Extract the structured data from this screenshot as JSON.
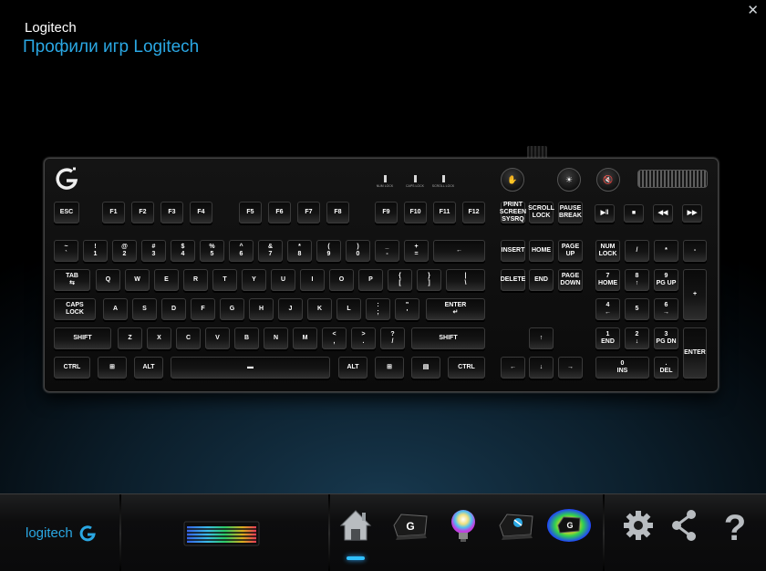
{
  "window": {
    "brand": "Logitech",
    "app_title": "Профили игр Logitech",
    "close_icon": "close-icon"
  },
  "keyboard": {
    "indicators": [
      "NUM LOCK",
      "CAPS LOCK",
      "SCROLL LOCK"
    ],
    "media_top": [
      "backlight-icon",
      "brightness-icon",
      "mute-icon"
    ],
    "keys": [
      {
        "name": "esc",
        "label": "ESC"
      },
      {
        "name": "f1",
        "label": "F1"
      },
      {
        "name": "f2",
        "label": "F2"
      },
      {
        "name": "f3",
        "label": "F3"
      },
      {
        "name": "f4",
        "label": "F4"
      },
      {
        "name": "f5",
        "label": "F5"
      },
      {
        "name": "f6",
        "label": "F6"
      },
      {
        "name": "f7",
        "label": "F7"
      },
      {
        "name": "f8",
        "label": "F8"
      },
      {
        "name": "f9",
        "label": "F9"
      },
      {
        "name": "f10",
        "label": "F10"
      },
      {
        "name": "f11",
        "label": "F11"
      },
      {
        "name": "f12",
        "label": "F12"
      },
      {
        "name": "print-screen",
        "label": "PRINT\nSCREEN\nSYSRQ"
      },
      {
        "name": "scroll-lock",
        "label": "SCROLL\nLOCK"
      },
      {
        "name": "pause-break",
        "label": "PAUSE\nBREAK"
      },
      {
        "name": "media-play-pause",
        "label": "▶ǁ"
      },
      {
        "name": "media-stop",
        "label": "■"
      },
      {
        "name": "media-prev",
        "label": "◀◀"
      },
      {
        "name": "media-next",
        "label": "▶▶"
      },
      {
        "name": "backtick",
        "label": "~\n`"
      },
      {
        "name": "digit-1",
        "label": "!\n1"
      },
      {
        "name": "digit-2",
        "label": "@\n2"
      },
      {
        "name": "digit-3",
        "label": "#\n3"
      },
      {
        "name": "digit-4",
        "label": "$\n4"
      },
      {
        "name": "digit-5",
        "label": "%\n5"
      },
      {
        "name": "digit-6",
        "label": "^\n6"
      },
      {
        "name": "digit-7",
        "label": "&\n7"
      },
      {
        "name": "digit-8",
        "label": "*\n8"
      },
      {
        "name": "digit-9",
        "label": "(\n9"
      },
      {
        "name": "digit-0",
        "label": ")\n0"
      },
      {
        "name": "minus",
        "label": "_\n-"
      },
      {
        "name": "equals",
        "label": "+\n="
      },
      {
        "name": "backspace",
        "label": "←"
      },
      {
        "name": "insert",
        "label": "INSERT"
      },
      {
        "name": "home",
        "label": "HOME"
      },
      {
        "name": "page-up",
        "label": "PAGE\nUP"
      },
      {
        "name": "num-lock",
        "label": "NUM\nLOCK"
      },
      {
        "name": "num-divide",
        "label": "/"
      },
      {
        "name": "num-multiply",
        "label": "*"
      },
      {
        "name": "num-minus",
        "label": "-"
      },
      {
        "name": "tab",
        "label": "TAB\n⇆"
      },
      {
        "name": "q",
        "label": "Q"
      },
      {
        "name": "w",
        "label": "W"
      },
      {
        "name": "e",
        "label": "E"
      },
      {
        "name": "r",
        "label": "R"
      },
      {
        "name": "t",
        "label": "T"
      },
      {
        "name": "y",
        "label": "Y"
      },
      {
        "name": "u",
        "label": "U"
      },
      {
        "name": "i",
        "label": "I"
      },
      {
        "name": "o",
        "label": "O"
      },
      {
        "name": "p",
        "label": "P"
      },
      {
        "name": "bracket-left",
        "label": "{\n["
      },
      {
        "name": "bracket-right",
        "label": "}\n]"
      },
      {
        "name": "backslash",
        "label": "|\n\\"
      },
      {
        "name": "delete",
        "label": "DELETE"
      },
      {
        "name": "end",
        "label": "END"
      },
      {
        "name": "page-down",
        "label": "PAGE\nDOWN"
      },
      {
        "name": "num-7",
        "label": "7\nHOME"
      },
      {
        "name": "num-8",
        "label": "8\n↑"
      },
      {
        "name": "num-9",
        "label": "9\nPG UP"
      },
      {
        "name": "num-plus",
        "label": "+"
      },
      {
        "name": "caps-lock",
        "label": "CAPS\nLOCK"
      },
      {
        "name": "a",
        "label": "A"
      },
      {
        "name": "s",
        "label": "S"
      },
      {
        "name": "d",
        "label": "D"
      },
      {
        "name": "f",
        "label": "F"
      },
      {
        "name": "g",
        "label": "G"
      },
      {
        "name": "h",
        "label": "H"
      },
      {
        "name": "j",
        "label": "J"
      },
      {
        "name": "k",
        "label": "K"
      },
      {
        "name": "l",
        "label": "L"
      },
      {
        "name": "semicolon",
        "label": ":\n;"
      },
      {
        "name": "quote",
        "label": "\"\n'"
      },
      {
        "name": "enter",
        "label": "ENTER\n↵"
      },
      {
        "name": "num-4",
        "label": "4\n←"
      },
      {
        "name": "num-5",
        "label": "5"
      },
      {
        "name": "num-6",
        "label": "6\n→"
      },
      {
        "name": "shift-left",
        "label": "SHIFT"
      },
      {
        "name": "z",
        "label": "Z"
      },
      {
        "name": "x",
        "label": "X"
      },
      {
        "name": "c",
        "label": "C"
      },
      {
        "name": "v",
        "label": "V"
      },
      {
        "name": "b",
        "label": "B"
      },
      {
        "name": "n",
        "label": "N"
      },
      {
        "name": "m",
        "label": "M"
      },
      {
        "name": "comma",
        "label": "<\n,"
      },
      {
        "name": "period",
        "label": ">\n."
      },
      {
        "name": "slash",
        "label": "?\n/"
      },
      {
        "name": "shift-right",
        "label": "SHIFT"
      },
      {
        "name": "arrow-up",
        "label": "↑"
      },
      {
        "name": "num-1",
        "label": "1\nEND"
      },
      {
        "name": "num-2",
        "label": "2\n↓"
      },
      {
        "name": "num-3",
        "label": "3\nPG DN"
      },
      {
        "name": "num-enter",
        "label": "ENTER"
      },
      {
        "name": "ctrl-left",
        "label": "CTRL"
      },
      {
        "name": "win-left",
        "label": "⊞"
      },
      {
        "name": "alt-left",
        "label": "ALT"
      },
      {
        "name": "space",
        "label": "▬"
      },
      {
        "name": "alt-right",
        "label": "ALT"
      },
      {
        "name": "win-right",
        "label": "⊞"
      },
      {
        "name": "menu",
        "label": "▤"
      },
      {
        "name": "ctrl-right",
        "label": "CTRL"
      },
      {
        "name": "arrow-left",
        "label": "←"
      },
      {
        "name": "arrow-down",
        "label": "↓"
      },
      {
        "name": "arrow-right",
        "label": "→"
      },
      {
        "name": "num-0",
        "label": "0\nINS"
      },
      {
        "name": "num-decimal",
        "label": ".\nDEL"
      }
    ]
  },
  "bottom_bar": {
    "logo_text": "logitech",
    "nav": [
      {
        "name": "home",
        "icon": "home-icon",
        "active": true
      },
      {
        "name": "g-keys",
        "icon": "g-key-icon",
        "active": false
      },
      {
        "name": "lighting",
        "icon": "lighting-bulb-icon",
        "active": false
      },
      {
        "name": "gaming-mode",
        "icon": "gaming-mode-icon",
        "active": false
      },
      {
        "name": "heatmap",
        "icon": "heatmap-icon",
        "active": false
      }
    ],
    "settings_icon": "gear-icon",
    "share_icon": "share-icon",
    "help_icon": "help-icon"
  }
}
